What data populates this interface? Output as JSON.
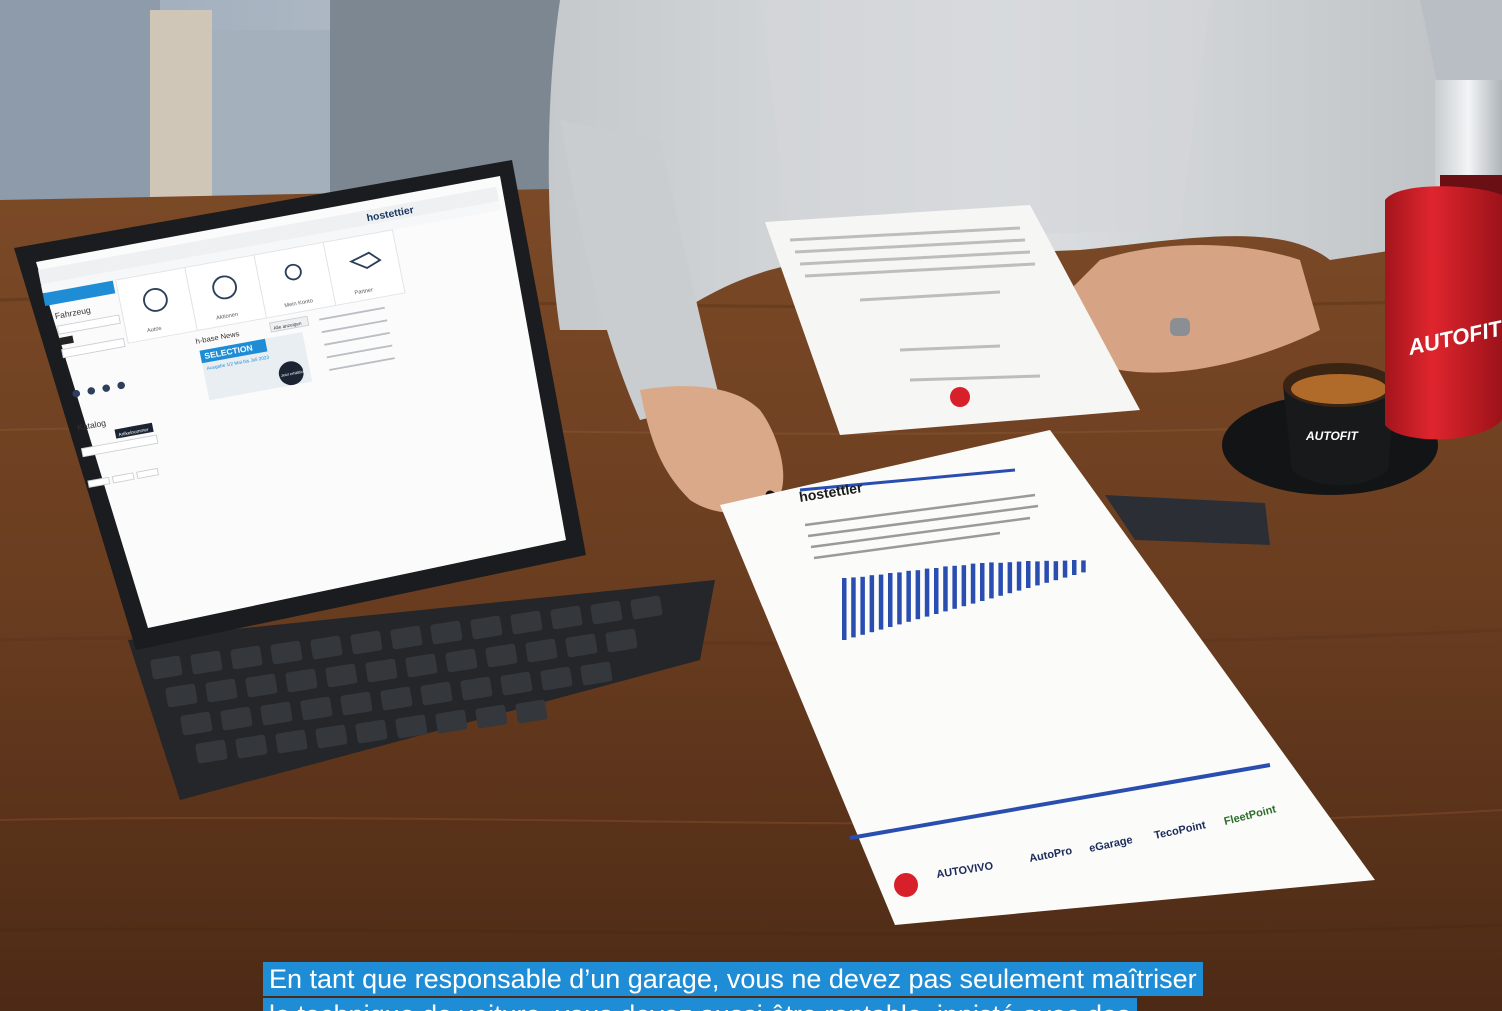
{
  "tablet": {
    "brand": "hostettier",
    "menu_tiles": [
      "Autos",
      "Aktionen",
      "Mein Konto",
      "Partner"
    ],
    "section_vehicle": "Fahrzeug",
    "section_news": "h-base News",
    "news_button": "Alle anzeigen",
    "promo_title": "SELECTION",
    "promo_subtitle": "Ausgabe 1/2 Mai bis Juli 2023",
    "promo_badge": "Jetzt erhältlich",
    "section_catalog": "Katalog",
    "catalog_tab": "Artikelnummer"
  },
  "report": {
    "header": "hostettler",
    "bar_values": [
      62,
      60,
      58,
      57,
      55,
      54,
      52,
      51,
      49,
      48,
      46,
      45,
      43,
      41,
      40,
      38,
      36,
      33,
      31,
      29,
      27,
      24,
      22,
      19,
      17,
      15,
      12
    ],
    "logos": [
      "AUTOVIVO",
      "AutoPro",
      "eGarage",
      "TecoPoint",
      "FleetPoint"
    ]
  },
  "bottle": {
    "brand": "AUTOFIT"
  },
  "cup": {
    "brand": "AUTOFIT"
  },
  "caption": {
    "line1": "En tant que responsable d’un garage, vous ne devez pas seulement maîtriser",
    "line2": "le technique de voiture, vous devez aussi être rentable, innisté avec des"
  },
  "colors": {
    "caption_bg": "#1f8dd6",
    "table_wood": "#6e4123",
    "bar_blue": "#2a4db0",
    "bottle_red": "#d8202a"
  }
}
